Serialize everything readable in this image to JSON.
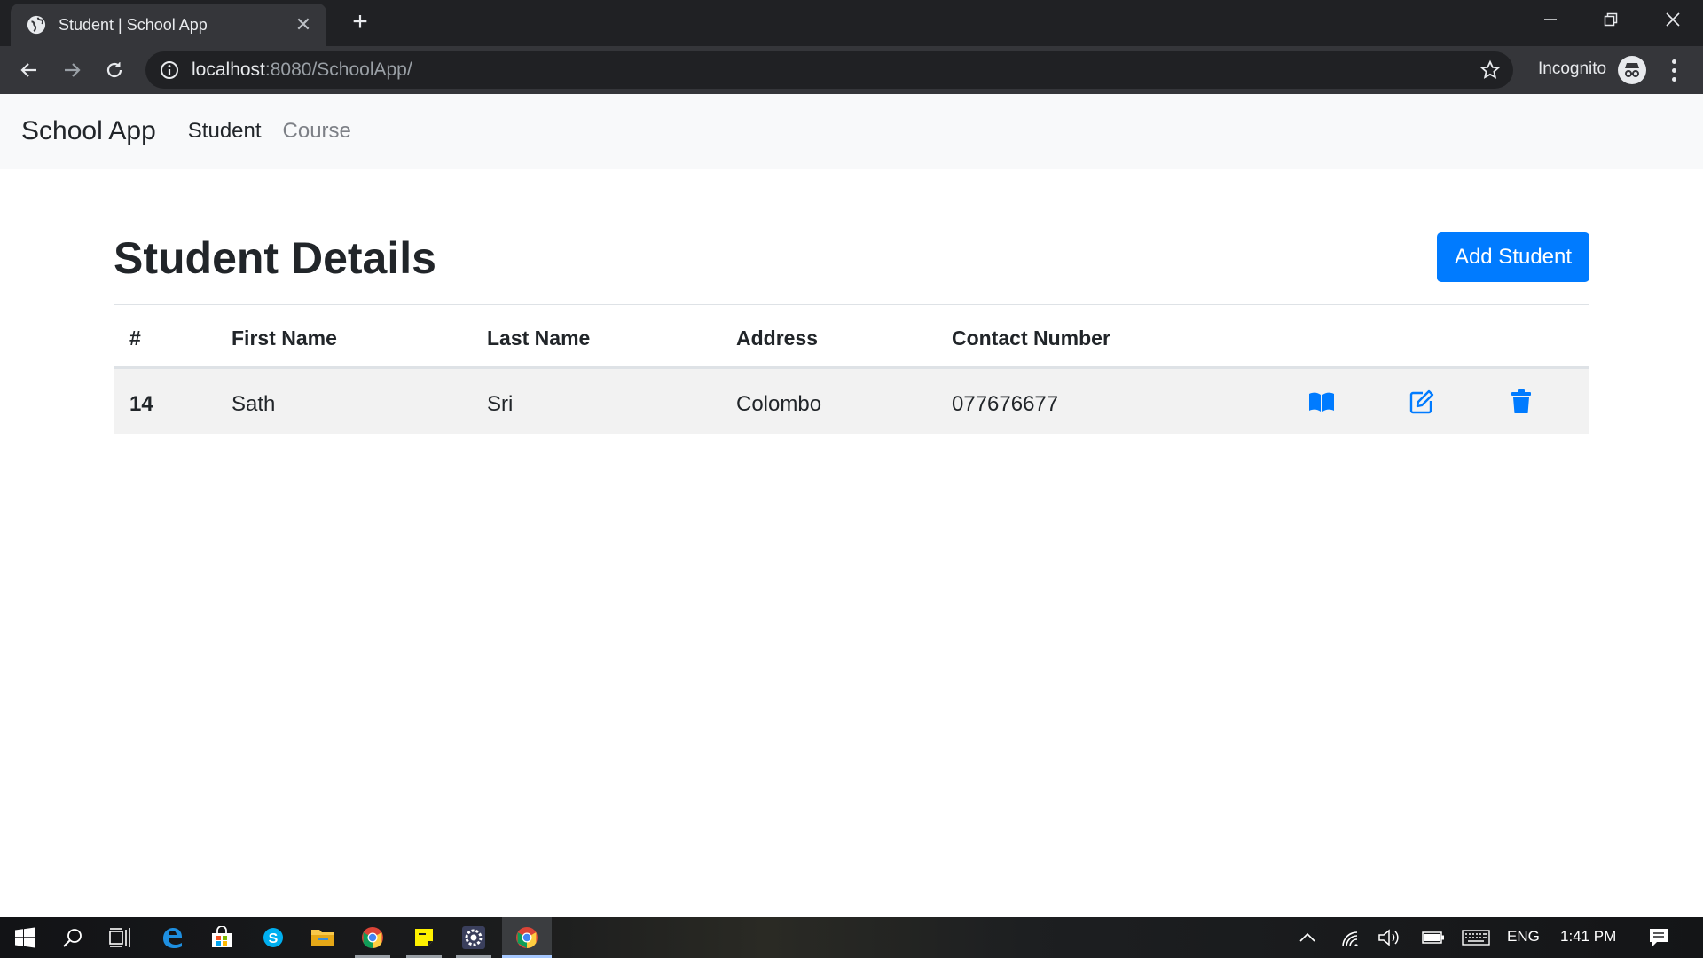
{
  "browser": {
    "tab_title": "Student | School App",
    "new_tab_symbol": "+",
    "url_host": "localhost",
    "url_rest": ":8080/SchoolApp/",
    "incognito_label": "Incognito"
  },
  "app": {
    "brand": "School App",
    "nav": [
      {
        "label": "Student",
        "active": true
      },
      {
        "label": "Course",
        "active": false
      }
    ]
  },
  "page": {
    "title": "Student Details",
    "add_button": "Add Student"
  },
  "table": {
    "headers": [
      "#",
      "First Name",
      "Last Name",
      "Address",
      "Contact Number"
    ],
    "rows": [
      {
        "id": "14",
        "first_name": "Sath",
        "last_name": "Sri",
        "address": "Colombo",
        "contact": "077676677",
        "actions": [
          "book-icon",
          "edit-icon",
          "trash-icon"
        ]
      }
    ]
  },
  "taskbar": {
    "icons": [
      "windows-start-icon",
      "search-icon",
      "task-view-icon",
      "edge-icon",
      "store-icon",
      "skype-icon",
      "file-explorer-icon",
      "chrome-icon",
      "sticky-notes-icon",
      "settings-app-icon",
      "chrome-icon"
    ],
    "language": "ENG",
    "time": "1:41 PM"
  },
  "colors": {
    "accent": "#007bff",
    "navbar_bg": "#f8f9fa",
    "row_stripe": "#f2f2f2",
    "chrome_dark": "#202124",
    "chrome_toolbar": "#35363a"
  }
}
